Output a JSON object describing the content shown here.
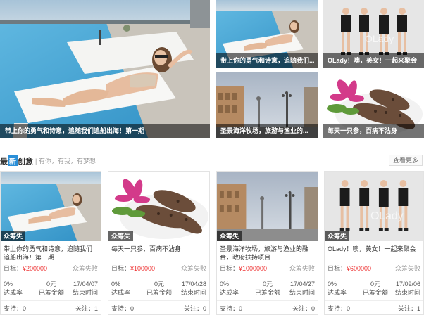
{
  "hero": {
    "big_caption": "带上你的勇气和诗意，追随我们追船出海！第一期",
    "tile_a_caption": "带上你的勇气和诗意，追随我们...",
    "tile_b_caption": "OLady！噢，美女！一起来聚会",
    "tile_c_caption": "圣景海洋牧场，旅游与渔业的...",
    "tile_d_caption": "每天一只参，百病不沾身"
  },
  "section": {
    "title_pre": "最",
    "title_hl": "新",
    "title_post": "创意",
    "subtitle": "| 有你，有我，有梦想",
    "more": "查看更多"
  },
  "labels": {
    "goal": "目标：",
    "rate": "达成率",
    "raised": "已筹金额",
    "end": "结束时间",
    "supporters": "支持：",
    "follows": "关注："
  },
  "cards": [
    {
      "badge": "众筹失",
      "title": "带上你的勇气和诗意，追随我们追船出海！第一期",
      "goal": "¥200000",
      "status": "众筹失败",
      "rate": "0%",
      "raised": "0元",
      "end": "17/04/07",
      "supporters": "0",
      "follows": "1"
    },
    {
      "badge": "众筹失",
      "title": "每天一只参，百病不沾身",
      "goal": "¥100000",
      "status": "众筹失败",
      "rate": "0%",
      "raised": "0元",
      "end": "17/04/28",
      "supporters": "0",
      "follows": "0"
    },
    {
      "badge": "众筹失",
      "title": "圣景海洋牧场，旅游与渔业的融合，政府扶持项目",
      "goal": "¥1000000",
      "status": "众筹失败",
      "rate": "0%",
      "raised": "0元",
      "end": "17/04/27",
      "supporters": "0",
      "follows": "0"
    },
    {
      "badge": "众筹失",
      "title": "OLady！噢，美女！一起来聚会",
      "goal": "¥600000",
      "status": "众筹失败",
      "rate": "0%",
      "raised": "0元",
      "end": "17/09/06",
      "supporters": "0",
      "follows": "1"
    }
  ],
  "watermark": "OLady",
  "colors": {
    "accent": "#2a8fd8",
    "goal_amount": "#e33333",
    "caption_bg": "#000000"
  }
}
